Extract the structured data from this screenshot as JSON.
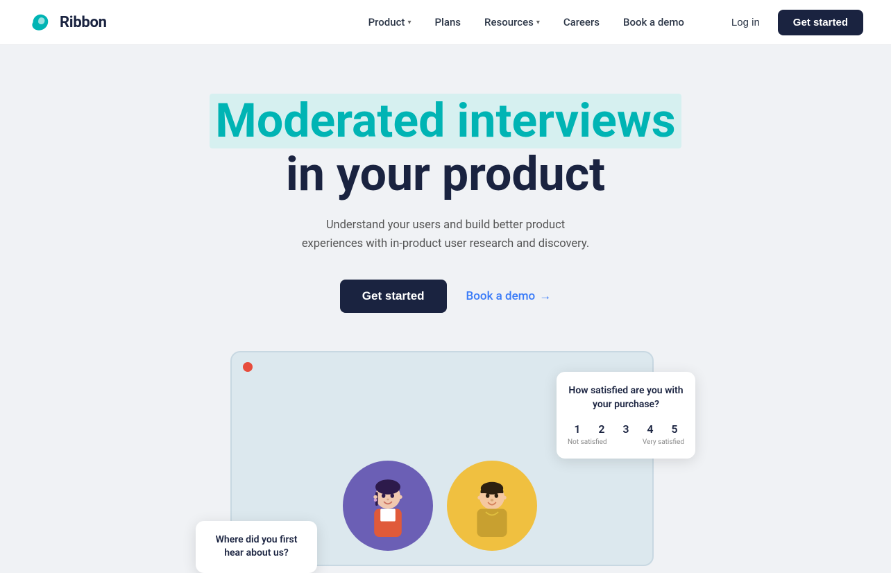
{
  "brand": {
    "name": "Ribbon",
    "logo_color": "#00b4b4"
  },
  "nav": {
    "links": [
      {
        "label": "Product",
        "has_dropdown": true
      },
      {
        "label": "Plans",
        "has_dropdown": false
      },
      {
        "label": "Resources",
        "has_dropdown": true
      },
      {
        "label": "Careers",
        "has_dropdown": false
      },
      {
        "label": "Book a demo",
        "has_dropdown": false
      }
    ],
    "login_label": "Log in",
    "get_started_label": "Get started"
  },
  "hero": {
    "headline_highlight": "Moderated interviews",
    "headline_rest": "in your product",
    "subtext": "Understand your users and build better product experiences with in-product user research and discovery.",
    "cta_primary": "Get started",
    "cta_secondary": "Book a demo",
    "cta_secondary_arrow": "→"
  },
  "demo": {
    "satisfaction_card": {
      "title": "How satisfied are you with your purchase?",
      "ratings": [
        "1",
        "2",
        "3",
        "4",
        "5"
      ],
      "label_left": "Not satisfied",
      "label_right": "Very satisfied"
    },
    "hear_card": {
      "title": "Where did you first hear about us?"
    }
  }
}
